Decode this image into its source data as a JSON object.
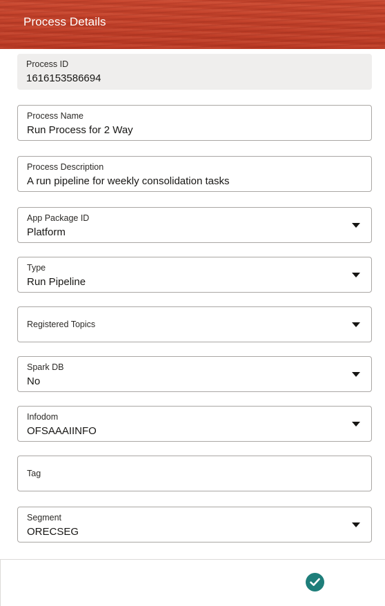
{
  "header": {
    "title": "Process Details"
  },
  "fields": {
    "process_id": {
      "label": "Process ID",
      "value": "1616153586694"
    },
    "process_name": {
      "label": "Process Name",
      "value": "Run Process for 2 Way"
    },
    "process_description": {
      "label": "Process Description",
      "value": "A run pipeline for weekly consolidation tasks"
    },
    "app_package_id": {
      "label": "App Package ID",
      "value": "Platform"
    },
    "type": {
      "label": "Type",
      "value": "Run Pipeline"
    },
    "registered_topics": {
      "label": "Registered Topics",
      "value": ""
    },
    "spark_db": {
      "label": "Spark DB",
      "value": "No"
    },
    "infodom": {
      "label": "Infodom",
      "value": "OFSAAAIINFO"
    },
    "tag": {
      "label": "Tag",
      "value": ""
    },
    "segment": {
      "label": "Segment",
      "value": "ORECSEG"
    }
  },
  "icons": {
    "dropdown": "chevron-down-icon",
    "confirm": "checkmark-icon"
  },
  "colors": {
    "header_background": "#c7432c",
    "confirm_button": "#1e7e7a",
    "readonly_background": "#efeeed"
  }
}
